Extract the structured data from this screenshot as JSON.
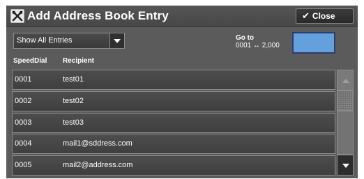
{
  "title": "Add Address Book Entry",
  "close_button": {
    "label": "Close"
  },
  "filter_dropdown": {
    "selected": "Show All Entries"
  },
  "goto": {
    "label": "Go to",
    "range": "0001 ↔ 2,000",
    "value": ""
  },
  "columns": {
    "speed_dial": "SpeedDial",
    "recipient": "Recipient"
  },
  "entries": [
    {
      "speed_dial": "0001",
      "recipient": "test01"
    },
    {
      "speed_dial": "0002",
      "recipient": "test02"
    },
    {
      "speed_dial": "0003",
      "recipient": "test03"
    },
    {
      "speed_dial": "0004",
      "recipient": "mail1@sddress.com"
    },
    {
      "speed_dial": "0005",
      "recipient": "mail2@address.com"
    }
  ],
  "icons": {
    "title": "tools-icon",
    "close": "checkmark-icon",
    "dropdown": "triangle-down-icon"
  },
  "colors": {
    "goto_input": "#64a0dc",
    "panel": "#5b5b5b"
  }
}
